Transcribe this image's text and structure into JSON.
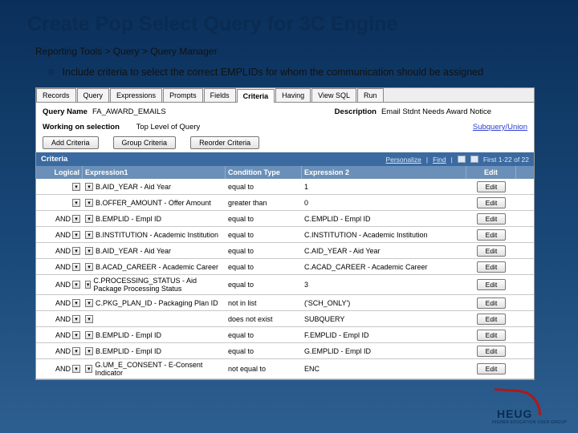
{
  "slide": {
    "title": "Create Pop Select Query for 3C Engine",
    "breadcrumb": "Reporting Tools > Query > Query Manager",
    "bullet_marker": "o",
    "bullet_text": "Include criteria to select the correct EMPLIDs for whom the communication should be assigned"
  },
  "tabs": [
    "Records",
    "Query",
    "Expressions",
    "Prompts",
    "Fields",
    "Criteria",
    "Having",
    "View SQL",
    "Run"
  ],
  "active_tab": "Criteria",
  "query": {
    "name_label": "Query Name",
    "name_value": "FA_AWARD_EMAILS",
    "desc_label": "Description",
    "desc_value": "Email Stdnt Needs Award Notice",
    "working_label": "Working on selection",
    "working_value": "Top Level of Query",
    "subquery_link": "Subquery/Union"
  },
  "buttons": {
    "add": "Add Criteria",
    "group": "Group Criteria",
    "reorder": "Reorder Criteria"
  },
  "grid": {
    "bar_label": "Criteria",
    "personalize": "Personalize",
    "find": "Find",
    "range": "First 1-22 of 22",
    "headers": {
      "logical": "Logical",
      "exp1": "Expression1",
      "cond": "Condition Type",
      "exp2": "Expression 2",
      "edit": "Edit"
    },
    "edit_label": "Edit",
    "rows": [
      {
        "logical": "",
        "exp1": "B.AID_YEAR - Aid Year",
        "cond": "equal to",
        "exp2": "1"
      },
      {
        "logical": "",
        "exp1": "B.OFFER_AMOUNT - Offer Amount",
        "cond": "greater than",
        "exp2": "0"
      },
      {
        "logical": "AND",
        "exp1": "B.EMPLID - Empl ID",
        "cond": "equal to",
        "exp2": "C.EMPLID - Empl ID"
      },
      {
        "logical": "AND",
        "exp1": "B.INSTITUTION - Academic Institution",
        "cond": "equal to",
        "exp2": "C.INSTITUTION - Academic Institution"
      },
      {
        "logical": "AND",
        "exp1": "B.AID_YEAR - Aid Year",
        "cond": "equal to",
        "exp2": "C.AID_YEAR - Aid Year"
      },
      {
        "logical": "AND",
        "exp1": "B.ACAD_CAREER - Academic Career",
        "cond": "equal to",
        "exp2": "C.ACAD_CAREER - Academic Career"
      },
      {
        "logical": "AND",
        "exp1": "C.PROCESSING_STATUS - Aid Package Processing Status",
        "cond": "equal to",
        "exp2": "3"
      },
      {
        "logical": "AND",
        "exp1": "C.PKG_PLAN_ID - Packaging Plan ID",
        "cond": "not in list",
        "exp2": "('SCH_ONLY')"
      },
      {
        "logical": "AND",
        "exp1": "",
        "cond": "does not exist",
        "exp2": "SUBQUERY"
      },
      {
        "logical": "AND",
        "exp1": "B.EMPLID - Empl ID",
        "cond": "equal to",
        "exp2": "F.EMPLID - Empl ID"
      },
      {
        "logical": "AND",
        "exp1": "B.EMPLID - Empl ID",
        "cond": "equal to",
        "exp2": "G.EMPLID - Empl ID"
      },
      {
        "logical": "AND",
        "exp1": "G.UM_E_CONSENT - E-Consent Indicator",
        "cond": "not equal to",
        "exp2": "ENC"
      }
    ]
  },
  "logo": {
    "text": "HEUG",
    "sub": "HIGHER EDUCATION USER GROUP"
  }
}
